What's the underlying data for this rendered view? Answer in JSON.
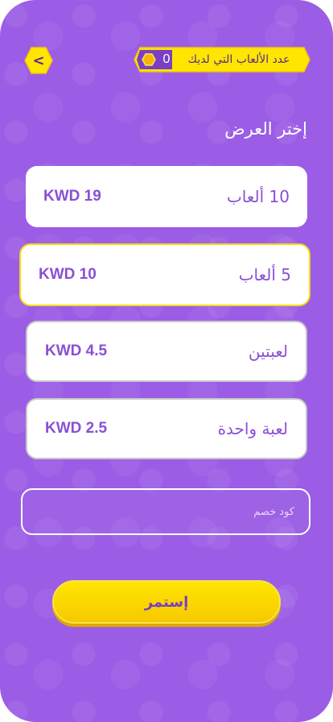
{
  "header": {
    "back_icon": "chevron-left-icon",
    "games_label": "عدد الألعاب التي لديك",
    "games_count": "0",
    "coin_icon": "hexagon-coin-icon"
  },
  "main": {
    "section_title": "إختر العرض",
    "offers": [
      {
        "name": "10 ألعاب",
        "price": "KWD 19"
      },
      {
        "name": "5 ألعاب",
        "price": "KWD 10"
      },
      {
        "name": "لعبتين",
        "price": "KWD 4.5"
      },
      {
        "name": "لعبة واحدة",
        "price": "KWD 2.5"
      }
    ],
    "selected_offer": "5 ألعاب",
    "promo_placeholder": "كود خصم",
    "promo_value": "",
    "continue_label": "إستمر"
  },
  "colors": {
    "background": "#9b5de5",
    "accent_yellow": "#ffe600",
    "accent_purple": "#8a4fd6"
  }
}
